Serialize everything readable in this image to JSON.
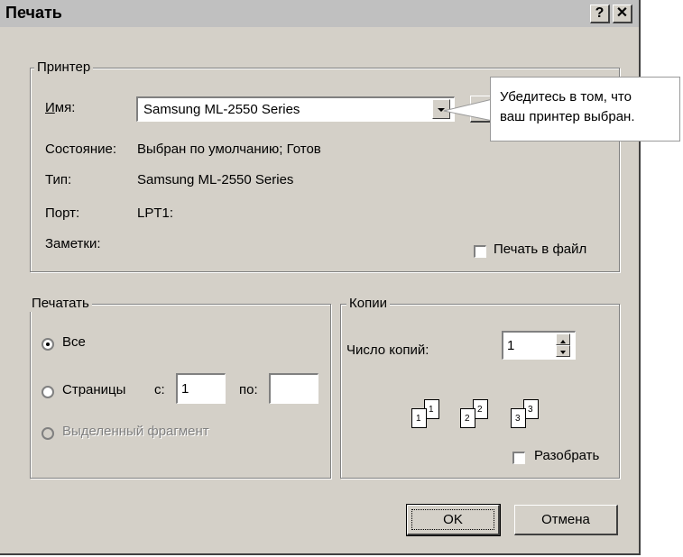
{
  "title": "Печать",
  "title_buttons": {
    "help": "?",
    "close": "✕"
  },
  "printer": {
    "legend": "Принтер",
    "name_label": "Имя:",
    "name_value": "Samsung ML-2550 Series",
    "status_label": "Состояние:",
    "status_value": "Выбран по умолчанию; Готов",
    "type_label": "Тип:",
    "type_value": "Samsung ML-2550 Series",
    "port_label": "Порт:",
    "port_value": "LPT1:",
    "notes_label": "Заметки:",
    "print_to_file": "Печать в файл"
  },
  "range": {
    "legend": "Печатать",
    "all": "Все",
    "pages": "Страницы",
    "from_label": "с:",
    "from_value": "1",
    "to_label": "по:",
    "to_value": "",
    "selection": "Выделенный фрагмент"
  },
  "copies": {
    "legend": "Копии",
    "count_label": "Число копий:",
    "count_value": "1",
    "collate": "Разобрать",
    "collate_icon_digits": [
      "1",
      "1",
      "2",
      "2",
      "3",
      "3"
    ]
  },
  "buttons": {
    "ok": "OK",
    "cancel": "Отмена"
  },
  "callout": {
    "line1": "Убедитесь в том, что",
    "line2": "ваш принтер выбран."
  }
}
